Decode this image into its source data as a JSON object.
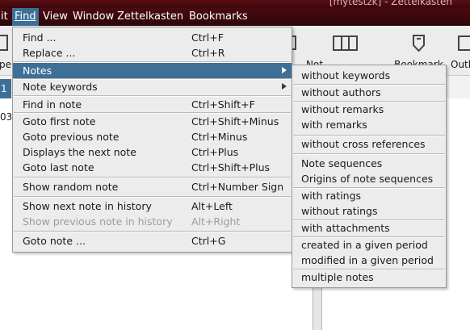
{
  "window": {
    "title": "[mytestzk] - Zettelkasten"
  },
  "menubar": {
    "items": [
      {
        "id": "edit",
        "label": "it"
      },
      {
        "id": "find",
        "label": "Find",
        "active": true
      },
      {
        "id": "view",
        "label": "View"
      },
      {
        "id": "window",
        "label": "Window"
      },
      {
        "id": "zettelkasten",
        "label": "Zettelkasten"
      },
      {
        "id": "bookmarks",
        "label": "Bookmarks"
      }
    ]
  },
  "toolbar": {
    "labels": [
      "pe",
      "Not",
      "Bookmark",
      "Outl"
    ],
    "icons": [
      "find-toolbar-icon",
      "columns-toolbar-icon",
      "bookmark-toolbar-icon",
      "outline-toolbar-icon"
    ]
  },
  "background": {
    "tab_number": "1",
    "left_number": "03"
  },
  "find_menu": {
    "items": [
      {
        "label": "Find ...",
        "shortcut": "Ctrl+F"
      },
      {
        "label": "Replace ...",
        "shortcut": "Ctrl+R"
      },
      {
        "label": "Notes",
        "submenu": true,
        "highlighted": true
      },
      {
        "label": "Note keywords",
        "submenu": true
      },
      {
        "label": "Find in note",
        "shortcut": "Ctrl+Shift+F"
      },
      {
        "label": "Goto first note",
        "shortcut": "Ctrl+Shift+Minus"
      },
      {
        "label": "Goto previous note",
        "shortcut": "Ctrl+Minus"
      },
      {
        "label": "Displays the next note",
        "shortcut": "Ctrl+Plus"
      },
      {
        "label": "Goto last note",
        "shortcut": "Ctrl+Shift+Plus"
      },
      {
        "label": "Show random note",
        "shortcut": "Ctrl+Number Sign"
      },
      {
        "label": "Show next note in history",
        "shortcut": "Alt+Left"
      },
      {
        "label": "Show previous note in history",
        "shortcut": "Alt+Right",
        "disabled": true
      },
      {
        "label": "Goto note ...",
        "shortcut": "Ctrl+G"
      }
    ]
  },
  "notes_submenu": {
    "items": [
      "without keywords",
      "without authors",
      "without remarks",
      "with remarks",
      "without cross references",
      "Note sequences",
      "Origins of note sequences",
      "with ratings",
      "without ratings",
      "with attachments",
      "created in a given period",
      "modified in a given period",
      "multiple notes"
    ]
  },
  "colors": {
    "menubar": "#3a080c",
    "highlight": "#3e6f97",
    "menu_bg": "#ececec",
    "disabled_text": "#9c9c9c"
  }
}
